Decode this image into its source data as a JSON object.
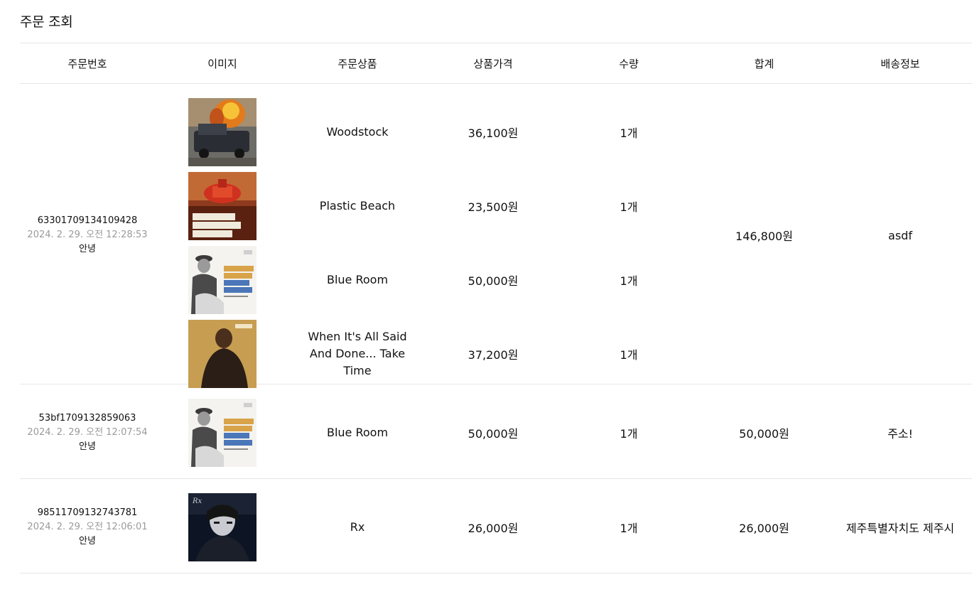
{
  "page": {
    "title": "주문 조회"
  },
  "columns": {
    "order_no": "주문번호",
    "image": "이미지",
    "product": "주문상품",
    "price": "상품가격",
    "qty": "수량",
    "total": "합계",
    "shipping": "배송정보"
  },
  "orders": [
    {
      "id": "63301709134109428",
      "date": "2024. 2. 29. 오전 12:28:53",
      "note": "안녕",
      "total": "146,800원",
      "shipping": "asdf",
      "items": [
        {
          "name": "Woodstock",
          "price": "36,100원",
          "qty": "1개",
          "cover": "woodstock-cover"
        },
        {
          "name": "Plastic Beach",
          "price": "23,500원",
          "qty": "1개",
          "cover": "plastic-beach-cover"
        },
        {
          "name": "Blue Room",
          "price": "50,000원",
          "qty": "1개",
          "cover": "blue-room-cover"
        },
        {
          "name": "When It's All Said And Done... Take Time",
          "price": "37,200원",
          "qty": "1개",
          "cover": "when-its-all-said-cover"
        }
      ]
    },
    {
      "id": "53bf1709132859063",
      "date": "2024. 2. 29. 오전 12:07:54",
      "note": "안녕",
      "total": "50,000원",
      "shipping": "주소!",
      "items": [
        {
          "name": "Blue Room",
          "price": "50,000원",
          "qty": "1개",
          "cover": "blue-room-cover"
        }
      ]
    },
    {
      "id": "98511709132743781",
      "date": "2024. 2. 29. 오전 12:06:01",
      "note": "안녕",
      "total": "26,000원",
      "shipping": "제주특별자치도 제주시",
      "items": [
        {
          "name": "Rx",
          "price": "26,000원",
          "qty": "1개",
          "cover": "rx-cover"
        }
      ]
    }
  ]
}
